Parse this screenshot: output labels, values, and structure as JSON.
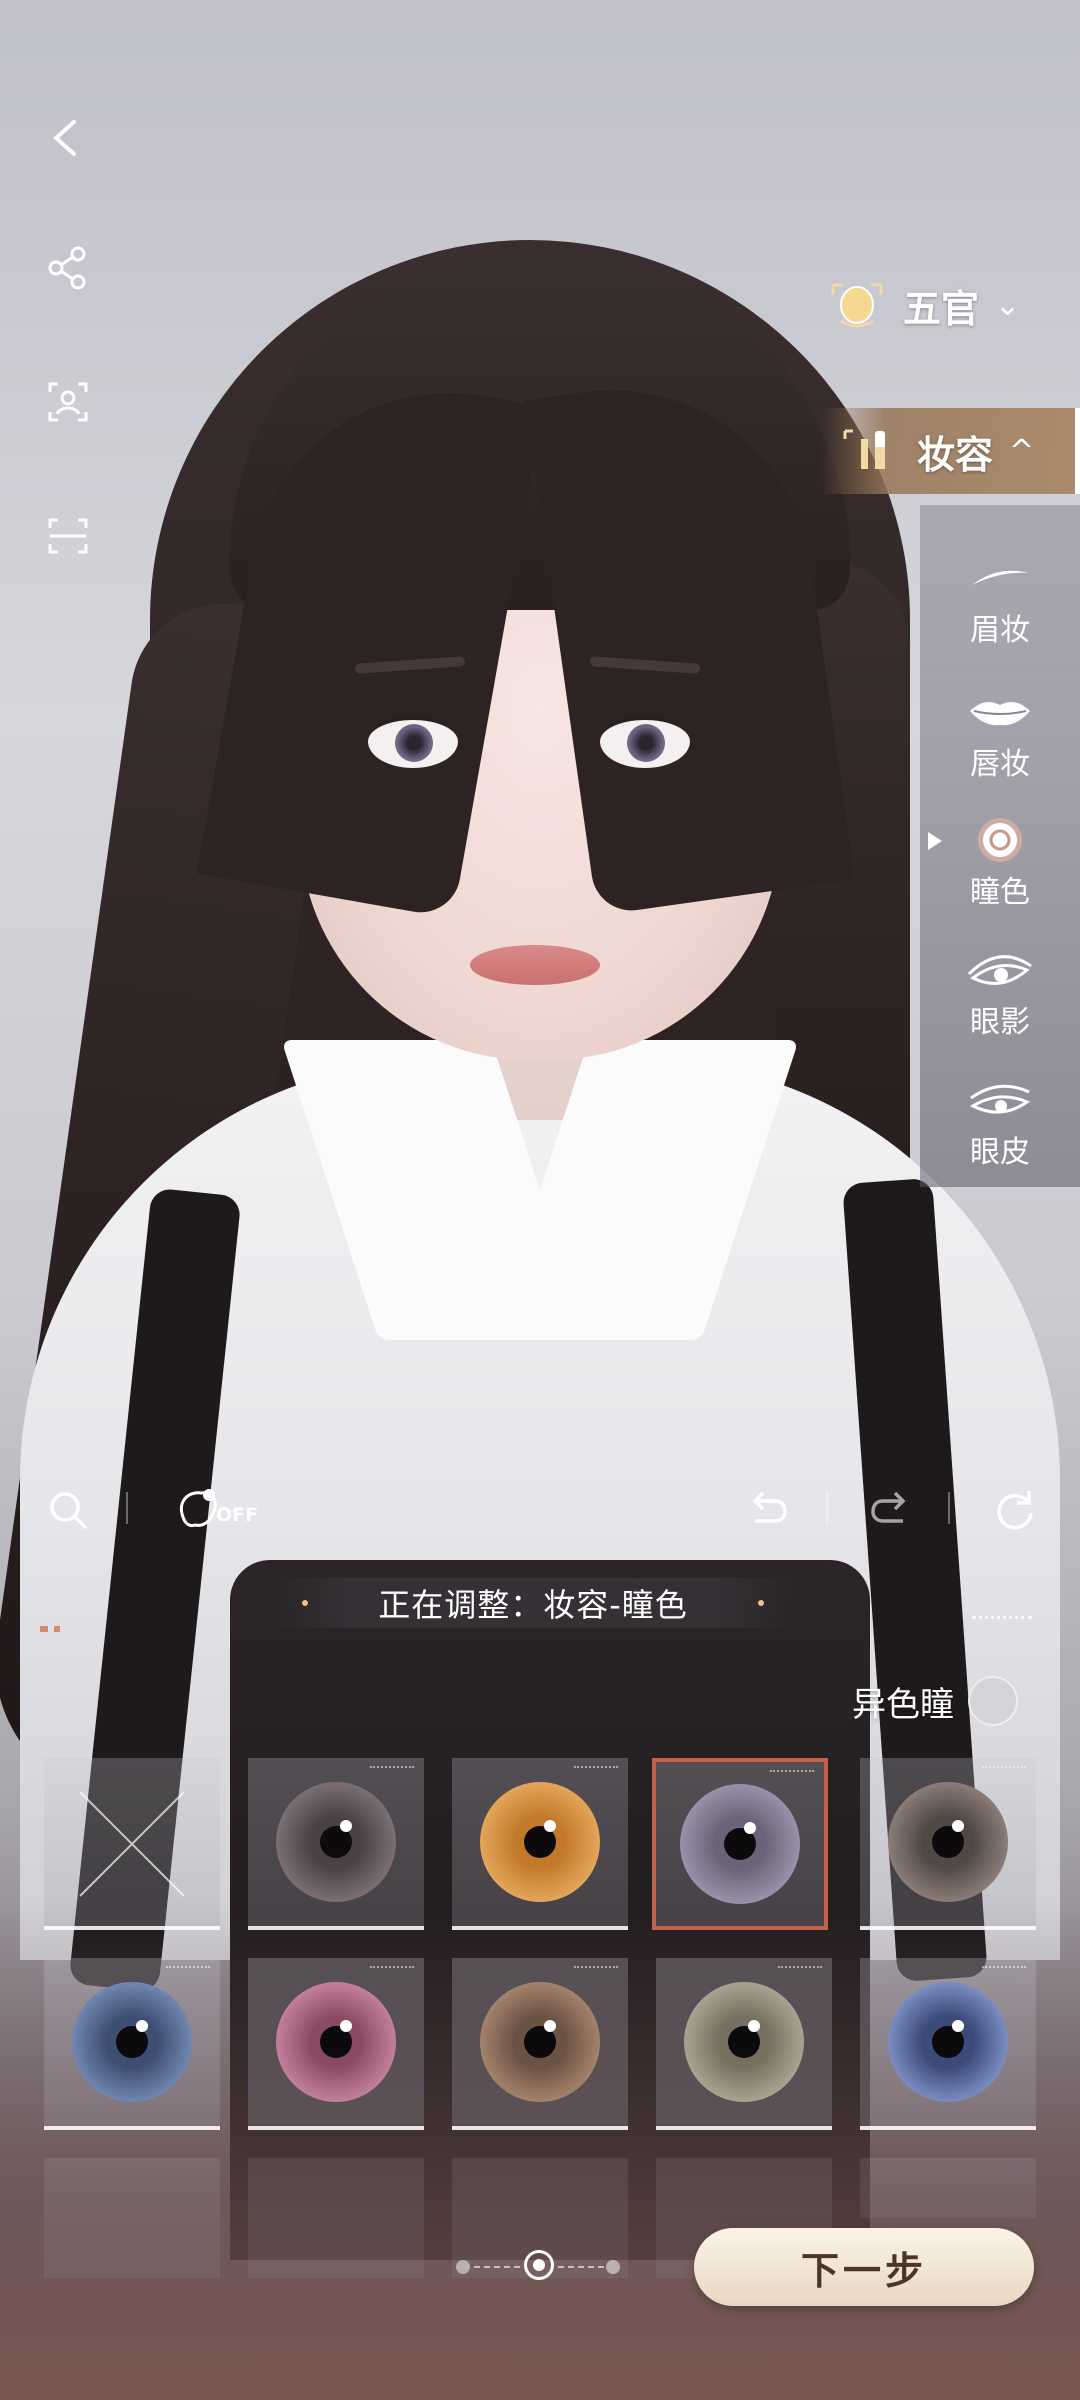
{
  "left_tools": [
    {
      "name": "back-icon"
    },
    {
      "name": "share-icon"
    },
    {
      "name": "face-scan-icon"
    },
    {
      "name": "screen-capture-icon"
    }
  ],
  "categories": {
    "facial": {
      "label": "五官",
      "chevron": "⌄",
      "icon": "face-mask-icon"
    },
    "makeup": {
      "label": "妆容",
      "chevron": "^",
      "icon": "cosmetics-icon"
    }
  },
  "makeup_items": [
    {
      "label": "眉妆",
      "icon": "eyebrow-icon"
    },
    {
      "label": "唇妆",
      "icon": "lips-icon"
    },
    {
      "label": "瞳色",
      "icon": "pupil-icon",
      "selected": true
    },
    {
      "label": "眼影",
      "icon": "eyeshadow-icon"
    },
    {
      "label": "眼皮",
      "icon": "eyelid-icon"
    }
  ],
  "toolbar": {
    "off_label": "OFF",
    "icons": [
      "search-icon",
      "hair-toggle-icon",
      "undo-icon",
      "redo-icon",
      "reset-icon"
    ]
  },
  "status": {
    "text": "正在调整：妆容-瞳色"
  },
  "heterochromia": {
    "label": "异色瞳",
    "enabled": false
  },
  "swatches": [
    {
      "type": "none"
    },
    {
      "color": "#4a4242",
      "ring": "#7a6f72",
      "selected": false
    },
    {
      "color": "#c27a2a",
      "ring": "#e3a55a",
      "selected": false
    },
    {
      "color": "#6b6478",
      "ring": "#9a90a8",
      "selected": true
    },
    {
      "color": "#504845",
      "ring": "#8a7c76",
      "selected": false
    },
    {
      "color": "#3e4e72",
      "ring": "#6f86b0",
      "selected": false
    },
    {
      "color": "#8a4a64",
      "ring": "#c27f9c",
      "selected": false
    },
    {
      "color": "#6a5244",
      "ring": "#a3826b",
      "selected": false
    },
    {
      "color": "#767060",
      "ring": "#a8a290",
      "selected": false
    },
    {
      "color": "#3b4a78",
      "ring": "#7a8cc0",
      "selected": false
    }
  ],
  "pager": {
    "pages": 3,
    "current": 2
  },
  "next_button": {
    "label": "下一步"
  }
}
